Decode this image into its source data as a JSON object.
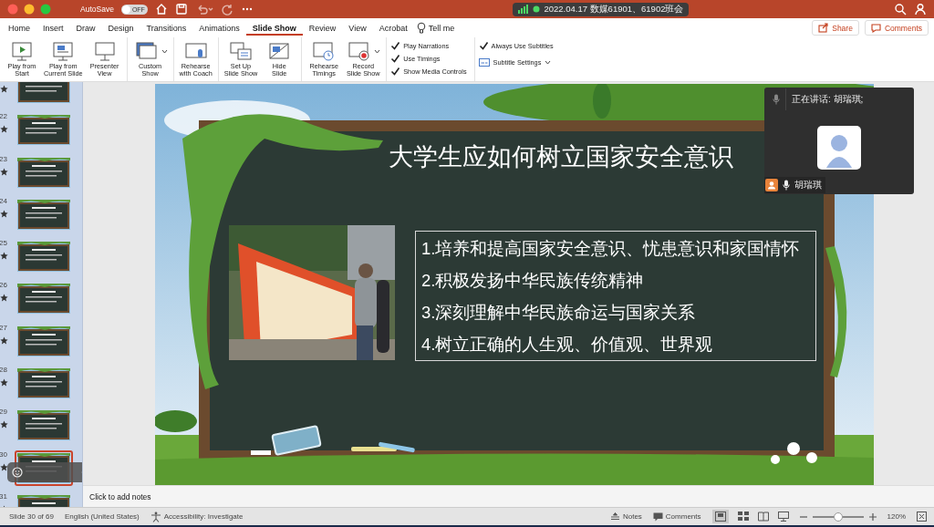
{
  "title_bar": {
    "autosave_label": "AutoSave",
    "autosave_toggle": {
      "label": "OFF",
      "on": false
    },
    "meeting_banner": "2022.04.17 数媒61901、61902班会"
  },
  "tabs": [
    {
      "label": "Home",
      "selected": false
    },
    {
      "label": "Insert",
      "selected": false
    },
    {
      "label": "Draw",
      "selected": false
    },
    {
      "label": "Design",
      "selected": false
    },
    {
      "label": "Transitions",
      "selected": false
    },
    {
      "label": "Animations",
      "selected": false
    },
    {
      "label": "Slide Show",
      "selected": true
    },
    {
      "label": "Review",
      "selected": false
    },
    {
      "label": "View",
      "selected": false
    },
    {
      "label": "Acrobat",
      "selected": false
    },
    {
      "label": "Tell me",
      "selected": false
    }
  ],
  "share_button": "Share",
  "comments_button": "Comments",
  "ribbon": {
    "groups": [
      {
        "kind": "buttons",
        "items": [
          {
            "label": "Play from\nStart",
            "dropdown": false
          },
          {
            "label": "Play from\nCurrent Slide",
            "dropdown": false
          },
          {
            "label": "Presenter\nView",
            "dropdown": false
          }
        ]
      },
      {
        "kind": "buttons",
        "items": [
          {
            "label": "Custom\nShow",
            "dropdown": true
          }
        ]
      },
      {
        "kind": "buttons",
        "items": [
          {
            "label": "Rehearse\nwith Coach",
            "dropdown": false
          }
        ]
      },
      {
        "kind": "buttons",
        "items": [
          {
            "label": "Set Up\nSlide Show",
            "dropdown": false
          },
          {
            "label": "Hide\nSlide",
            "dropdown": false
          }
        ]
      },
      {
        "kind": "buttons",
        "items": [
          {
            "label": "Rehearse\nTimings",
            "dropdown": false
          },
          {
            "label": "Record\nSlide Show",
            "dropdown": true
          }
        ]
      },
      {
        "kind": "options",
        "items": [
          {
            "kind": "check",
            "label": "Play Narrations",
            "checked": true
          },
          {
            "kind": "check",
            "label": "Use Timings",
            "checked": true
          },
          {
            "kind": "check",
            "label": "Show Media Controls",
            "checked": true
          }
        ]
      },
      {
        "kind": "options",
        "items": [
          {
            "kind": "check",
            "label": "Always Use Subtitles",
            "checked": true
          },
          {
            "kind": "menu",
            "label": "Subtitle Settings"
          }
        ]
      }
    ]
  },
  "slides": [
    {
      "selected": false
    },
    {
      "number": "22",
      "selected": false
    },
    {
      "number": "23",
      "selected": false
    },
    {
      "number": "24",
      "selected": false
    },
    {
      "number": "25",
      "selected": false
    },
    {
      "number": "26",
      "selected": false
    },
    {
      "number": "27",
      "selected": false
    },
    {
      "number": "28",
      "selected": false
    },
    {
      "number": "29",
      "selected": false
    },
    {
      "number": "30",
      "selected": true
    },
    {
      "number": "31",
      "selected": false
    }
  ],
  "slide": {
    "title": "大学生应如何树立国家安全意识",
    "points": [
      "1.培养和提高国家安全意识、忧患意识和家国情怀",
      "2.积极发扬中华民族传统精神",
      "3.深刻理解中华民族命运与国家关系",
      "4.树立正确的人生观、价值观、世界观"
    ]
  },
  "speaker_panel": {
    "speaking": "正在讲话: 胡瑞琪;",
    "name": "胡瑞琪"
  },
  "notes_placeholder": "Click to add notes",
  "status_bar": {
    "slide_count": "Slide 30 of 69",
    "language": "English (United States)",
    "accessibility": "Accessibility: Investigate",
    "notes": "Notes",
    "comments": "Comments",
    "zoom": {
      "level": 0.5,
      "reading": "120%"
    }
  }
}
